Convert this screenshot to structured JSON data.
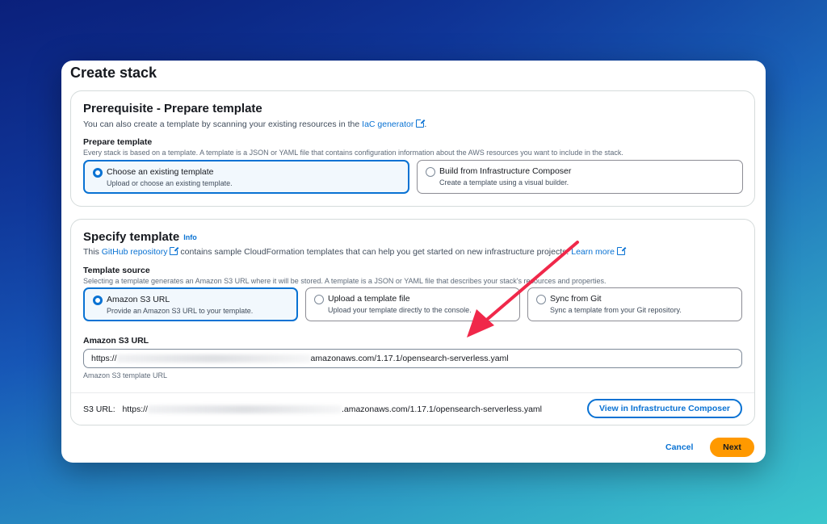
{
  "window": {
    "title": "Create stack"
  },
  "prereq": {
    "heading": "Prerequisite - Prepare template",
    "desc_before": "You can also create a template by scanning your existing resources in the ",
    "desc_link": "IaC generator",
    "desc_after": ".",
    "label": "Prepare template",
    "sublabel": "Every stack is based on a template. A template is a JSON or YAML file that contains configuration information about the AWS resources you want to include in the stack.",
    "options": [
      {
        "title": "Choose an existing template",
        "sub": "Upload or choose an existing template.",
        "selected": true
      },
      {
        "title": "Build from Infrastructure Composer",
        "sub": "Create a template using a visual builder.",
        "selected": false
      }
    ]
  },
  "specify": {
    "heading": "Specify template",
    "info": "Info",
    "desc_before": "This ",
    "desc_link": "GitHub repository",
    "desc_mid": " contains sample CloudFormation templates that can help you get started on new infrastructure projects. ",
    "desc_link2": "Learn more",
    "label": "Template source",
    "sublabel": "Selecting a template generates an Amazon S3 URL where it will be stored. A template is a JSON or YAML file that describes your stack's resources and properties.",
    "options": [
      {
        "title": "Amazon S3 URL",
        "sub": "Provide an Amazon S3 URL to your template.",
        "selected": true
      },
      {
        "title": "Upload a template file",
        "sub": "Upload your template directly to the console.",
        "selected": false
      },
      {
        "title": "Sync from Git",
        "sub": "Sync a template from your Git repository.",
        "selected": false
      }
    ],
    "url_label": "Amazon S3 URL",
    "url_prefix": "https://",
    "url_suffix": "amazonaws.com/1.17.1/opensearch-serverless.yaml",
    "url_hint": "Amazon S3 template URL",
    "s3_label": "S3 URL:",
    "s3_prefix": "https://",
    "s3_suffix": ".amazonaws.com/1.17.1/opensearch-serverless.yaml",
    "composer_button": "View in Infrastructure Composer"
  },
  "footer": {
    "cancel": "Cancel",
    "next": "Next"
  },
  "colors": {
    "accent": "#0972d3",
    "primary_button": "#ff9900",
    "annotation_arrow": "#f0284a"
  }
}
